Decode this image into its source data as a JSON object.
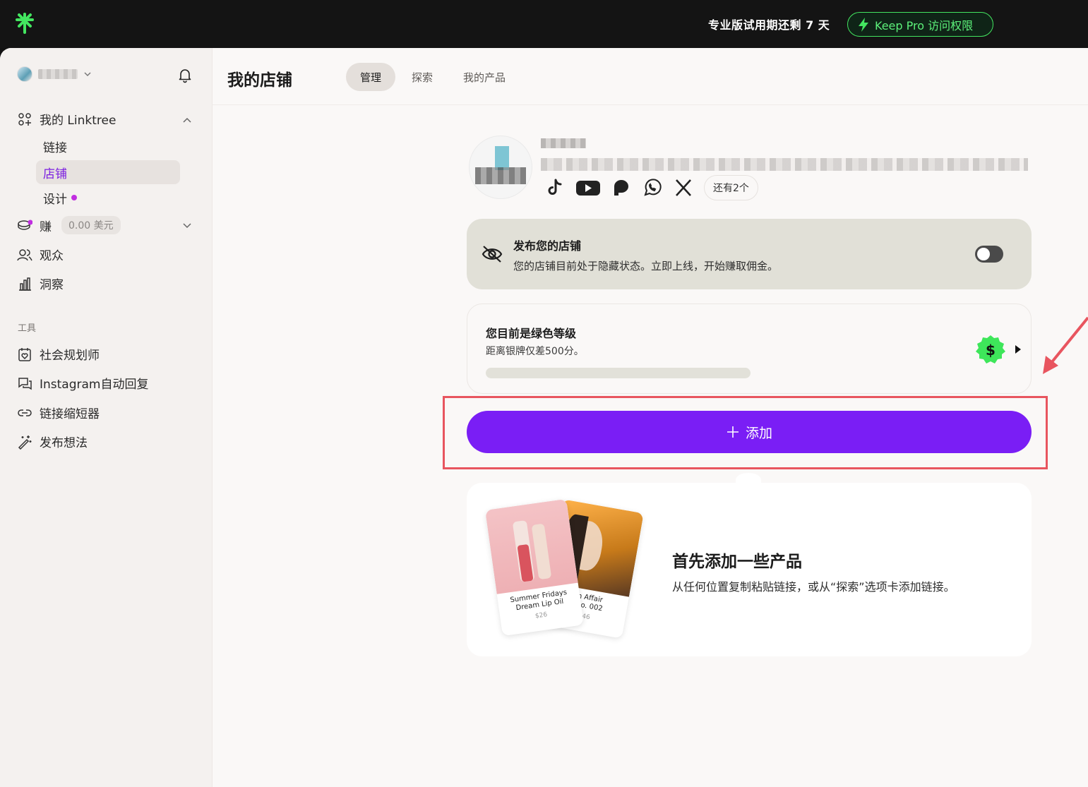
{
  "topbar": {
    "logo_icon": "linktree-asterisk-icon",
    "trial_text": "专业版试用期还剩 7 天",
    "pro_button": "Keep Pro 访问权限",
    "accent": "#43e660"
  },
  "sidebar": {
    "account_chevron": "chevron-down-icon",
    "notification_icon": "bell-icon",
    "my_linktree": "我的 Linktree",
    "sub_items": [
      {
        "label": "链接",
        "active": false
      },
      {
        "label": "店铺",
        "active": true
      },
      {
        "label": "设计",
        "active": false,
        "dot": true
      }
    ],
    "earn": {
      "label": "赚",
      "badge": "0.00 美元"
    },
    "audience": "观众",
    "insights": "洞察",
    "tools_label": "工具",
    "tools": [
      {
        "label": "社会规划师",
        "icon": "calendar-heart-icon"
      },
      {
        "label": "Instagram自动回复",
        "icon": "chat-icon"
      },
      {
        "label": "链接缩短器",
        "icon": "link-icon"
      },
      {
        "label": "发布想法",
        "icon": "magic-wand-icon"
      }
    ]
  },
  "header": {
    "title": "我的店铺",
    "tabs": [
      {
        "label": "管理",
        "active": true
      },
      {
        "label": "探索",
        "active": false
      },
      {
        "label": "我的产品",
        "active": false
      }
    ]
  },
  "profile": {
    "socials": [
      "tiktok-icon",
      "youtube-icon",
      "patreon-icon",
      "whatsapp-icon",
      "x-icon"
    ],
    "more": "还有2个"
  },
  "publish_card": {
    "title": "发布您的店铺",
    "subtitle": "您的店铺目前处于隐藏状态。立即上线，开始赚取佣金。",
    "toggle_on": false
  },
  "level_card": {
    "title": "您目前是绿色等级",
    "subtitle": "距离银牌仅差500分。",
    "progress": 0
  },
  "add_button": {
    "label": "添加",
    "color": "#7a1ef5"
  },
  "empty_state": {
    "title": "首先添加一些产品",
    "subtitle": "从任何位置复制粘贴链接，或从“探索”选项卡添加链接。",
    "products": [
      {
        "name1": "Summer Fridays",
        "name2": "Dream Lip Oil",
        "price": "$26"
      },
      {
        "name1": "wn Affair",
        "name2": "o No. 002",
        "price": "$46"
      }
    ]
  },
  "annotation_color": "#e8555f"
}
